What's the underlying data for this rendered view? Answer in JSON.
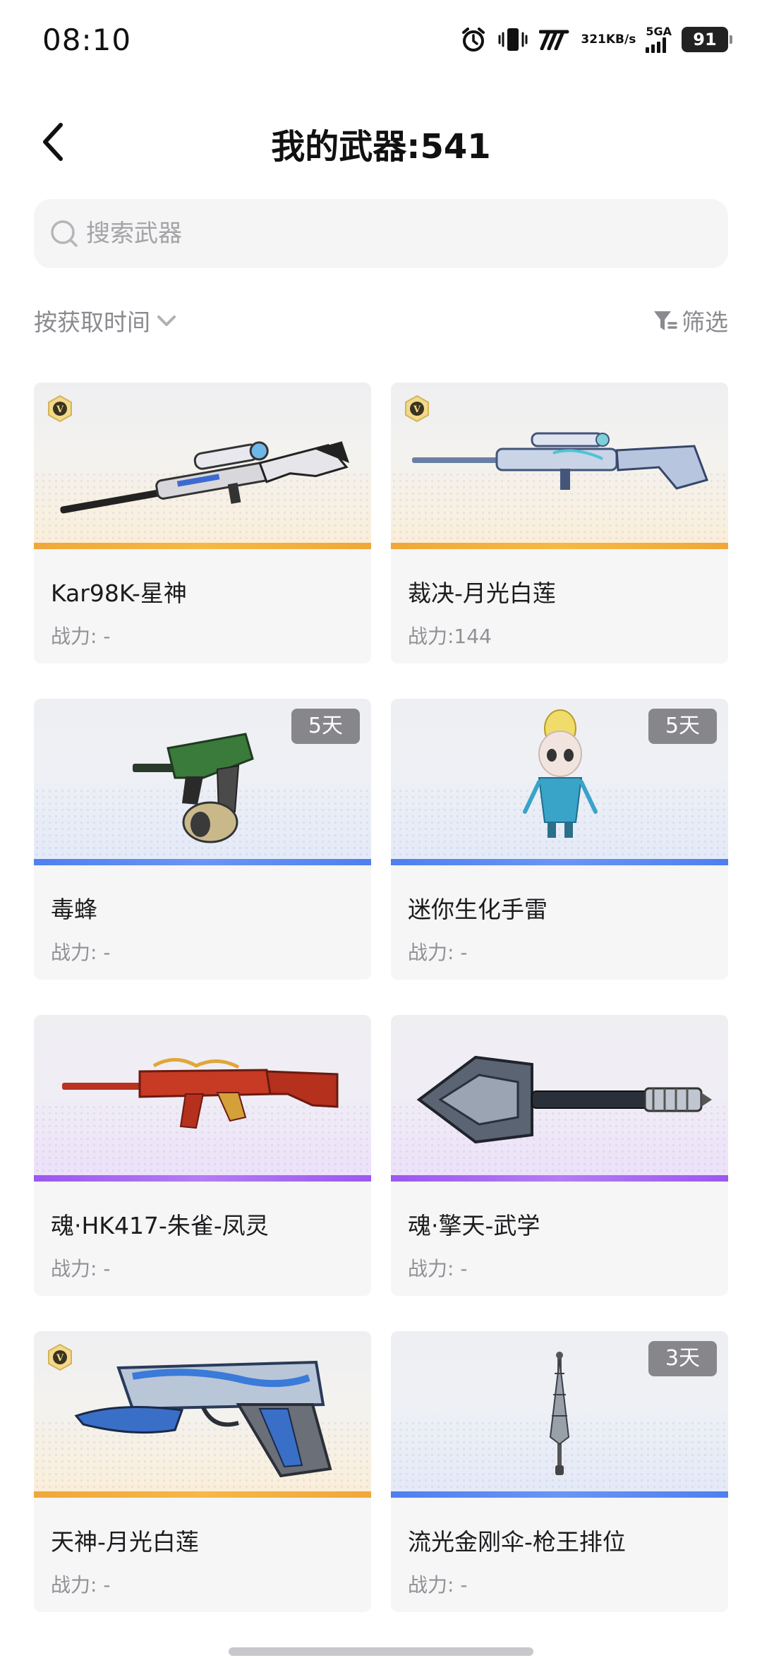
{
  "status_bar": {
    "time": "08:10",
    "speed_value": "321",
    "speed_unit": "KB/s",
    "network": "5GA",
    "battery": "91"
  },
  "header": {
    "title": "我的武器:541"
  },
  "search": {
    "placeholder": "搜索武器"
  },
  "toolbar": {
    "sort_label": "按获取时间",
    "filter_label": "筛选"
  },
  "weapons": [
    {
      "name": "Kar98K-星神",
      "power": "战力: -",
      "rarity": "gold",
      "v_badge": true,
      "days": ""
    },
    {
      "name": "裁决-月光白莲",
      "power": "战力:144",
      "rarity": "gold",
      "v_badge": true,
      "days": ""
    },
    {
      "name": "毒蜂",
      "power": "战力: -",
      "rarity": "blue",
      "v_badge": false,
      "days": "5天"
    },
    {
      "name": "迷你生化手雷",
      "power": "战力: -",
      "rarity": "blue",
      "v_badge": false,
      "days": "5天"
    },
    {
      "name": "魂·HK417-朱雀-凤灵",
      "power": "战力: -",
      "rarity": "purple",
      "v_badge": false,
      "days": ""
    },
    {
      "name": "魂·擎天-武学",
      "power": "战力: -",
      "rarity": "purple",
      "v_badge": false,
      "days": ""
    },
    {
      "name": "天神-月光白莲",
      "power": "战力: -",
      "rarity": "gold",
      "v_badge": true,
      "days": ""
    },
    {
      "name": "流光金刚伞-枪王排位",
      "power": "战力: -",
      "rarity": "blue",
      "v_badge": false,
      "days": "3天"
    }
  ],
  "colors": {
    "gold": "#f0a73a",
    "blue": "#4f7ff0",
    "purple": "#9b57f0"
  }
}
